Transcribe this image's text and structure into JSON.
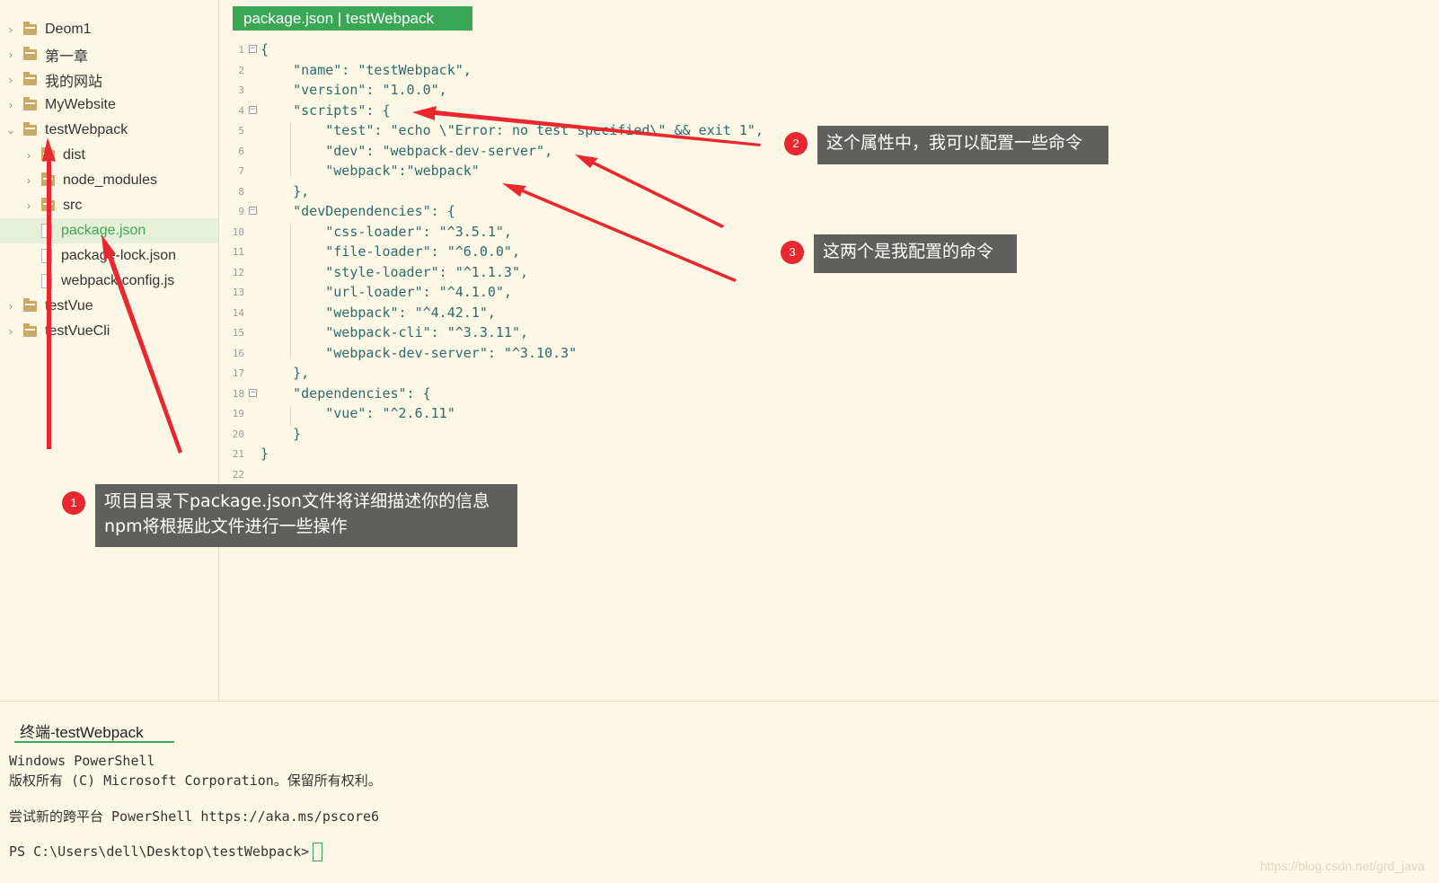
{
  "sidebar": {
    "items": [
      {
        "label": "Deom1",
        "kind": "folder",
        "expanded": false
      },
      {
        "label": "第一章",
        "kind": "folder",
        "expanded": false
      },
      {
        "label": "我的网站",
        "kind": "folder",
        "expanded": false
      },
      {
        "label": "MyWebsite",
        "kind": "folder",
        "expanded": false
      },
      {
        "label": "testWebpack",
        "kind": "folder",
        "expanded": true
      },
      {
        "label": "dist",
        "kind": "folder",
        "expanded": false
      },
      {
        "label": "node_modules",
        "kind": "folder",
        "expanded": false
      },
      {
        "label": "src",
        "kind": "folder",
        "expanded": false
      },
      {
        "label": "package.json",
        "kind": "file",
        "selected": true
      },
      {
        "label": "package-lock.json",
        "kind": "file"
      },
      {
        "label": "webpack.config.js",
        "kind": "file"
      },
      {
        "label": "testVue",
        "kind": "folder",
        "expanded": false
      },
      {
        "label": "testVueCli",
        "kind": "folder",
        "expanded": false
      }
    ]
  },
  "editor": {
    "tab_title": "package.json | testWebpack",
    "lines": [
      "{",
      "    \"name\": \"testWebpack\",",
      "    \"version\": \"1.0.0\",",
      "    \"scripts\": {",
      "        \"test\": \"echo \\\"Error: no test specified\\\" && exit 1\",",
      "        \"dev\": \"webpack-dev-server\",",
      "        \"webpack\":\"webpack\"",
      "    },",
      "    \"devDependencies\": {",
      "        \"css-loader\": \"^3.5.1\",",
      "        \"file-loader\": \"^6.0.0\",",
      "        \"style-loader\": \"^1.1.3\",",
      "        \"url-loader\": \"^4.1.0\",",
      "        \"webpack\": \"^4.42.1\",",
      "        \"webpack-cli\": \"^3.3.11\",",
      "        \"webpack-dev-server\": \"^3.10.3\"",
      "    },",
      "    \"dependencies\": {",
      "        \"vue\": \"^2.6.11\"",
      "    }",
      "}",
      ""
    ],
    "fold_lines": [
      1,
      4,
      9,
      18
    ]
  },
  "annotations": {
    "a1": {
      "number": "1",
      "text": "项目目录下package.json文件将详细描述你的信息\nnpm将根据此文件进行一些操作"
    },
    "a2": {
      "number": "2",
      "text": "这个属性中，我可以配置一些命令"
    },
    "a3": {
      "number": "3",
      "text": "这两个是我配置的命令"
    },
    "arrow_color": "#e8272f"
  },
  "terminal": {
    "tab_label": "终端-testWebpack",
    "lines": [
      "Windows PowerShell",
      "版权所有 (C) Microsoft Corporation。保留所有权利。",
      "",
      "尝试新的跨平台 PowerShell https://aka.ms/pscore6",
      "",
      "PS C:\\Users\\dell\\Desktop\\testWebpack>"
    ]
  },
  "watermark": "https://blog.csdn.net/grd_java",
  "colors": {
    "background": "#fdf8e6",
    "accent": "#3aa757",
    "callout_bg": "#5f5f5c",
    "badge": "#e8272f"
  }
}
